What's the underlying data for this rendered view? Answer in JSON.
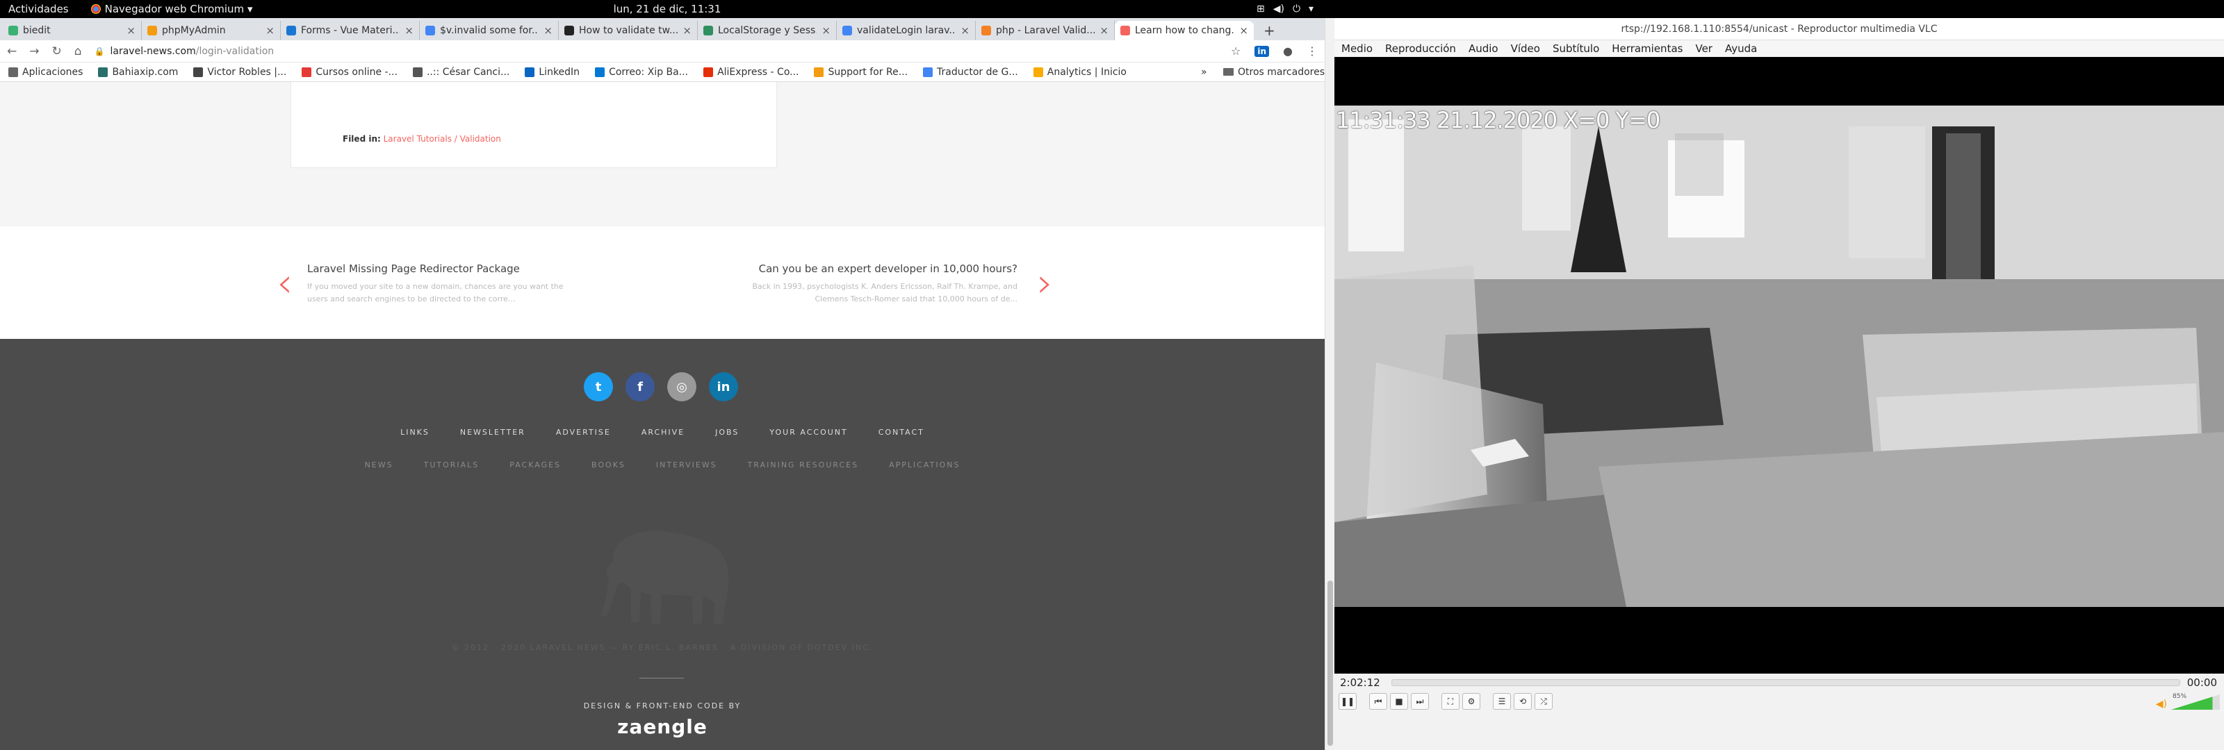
{
  "topbar": {
    "activities": "Actividades",
    "app_name": "Navegador web Chromium ▾",
    "clock": "lun, 21 de dic, 11:31"
  },
  "tabs": [
    {
      "title": "biedit",
      "color": "#3bb273"
    },
    {
      "title": "phpMyAdmin",
      "color": "#f39c12"
    },
    {
      "title": "Forms - Vue Materi...",
      "color": "#1976d2"
    },
    {
      "title": "$v.invalid some for...",
      "color": "#4285f4"
    },
    {
      "title": "How to validate tw...",
      "color": "#222"
    },
    {
      "title": "LocalStorage y Sess...",
      "color": "#2f8f5f"
    },
    {
      "title": "validateLogin larav...",
      "color": "#4285f4"
    },
    {
      "title": "php - Laravel Valid...",
      "color": "#f48024"
    },
    {
      "title": "Learn how to chang...",
      "color": "#f4645f"
    }
  ],
  "address": {
    "host": "laravel-news.com",
    "path": "/login-validation"
  },
  "bookmarks": [
    {
      "label": "Aplicaciones",
      "color": "#666"
    },
    {
      "label": "Bahiaxip.com",
      "color": "#2a6f6a"
    },
    {
      "label": "Victor Robles |...",
      "color": "#444"
    },
    {
      "label": "Cursos online -...",
      "color": "#e53935"
    },
    {
      "label": "..:: César Canci...",
      "color": "#555"
    },
    {
      "label": "LinkedIn",
      "color": "#0a66c2"
    },
    {
      "label": "Correo: Xip Ba...",
      "color": "#0078d4"
    },
    {
      "label": "AliExpress - Co...",
      "color": "#e62e04"
    },
    {
      "label": "Support for Re...",
      "color": "#f39c12"
    },
    {
      "label": "Traductor de G...",
      "color": "#4285f4"
    },
    {
      "label": "Analytics | Inicio",
      "color": "#f9ab00"
    }
  ],
  "bookmarks_more": "»",
  "bookmarks_other": "Otros marcadores",
  "article": {
    "filed_label": "Filed in:",
    "filed_links": "Laravel Tutorials / Validation"
  },
  "prev_post": {
    "title": "Laravel Missing Page Redirector Package",
    "desc1": "If you moved your site to a new domain, chances are you want the",
    "desc2": "users and search engines to be directed to the corre..."
  },
  "next_post": {
    "title": "Can you be an expert developer in 10,000 hours?",
    "desc1": "Back in 1993, psychologists K. Anders Ericsson, Ralf Th. Krampe, and",
    "desc2": "Clemens Tesch-Romer said that 10,000 hours of de..."
  },
  "social": [
    {
      "label": "t",
      "color": "#1da1f2"
    },
    {
      "label": "f",
      "color": "#3b5998"
    },
    {
      "label": "◎",
      "color": "#9a9a9a"
    },
    {
      "label": "in",
      "color": "#0e76a8"
    }
  ],
  "footer_links": [
    "LINKS",
    "NEWSLETTER",
    "ADVERTISE",
    "ARCHIVE",
    "JOBS",
    "YOUR ACCOUNT",
    "CONTACT"
  ],
  "footer_sub": [
    "NEWS",
    "TUTORIALS",
    "PACKAGES",
    "BOOKS",
    "INTERVIEWS",
    "TRAINING RESOURCES",
    "APPLICATIONS"
  ],
  "copyright": "© 2012 - 2020 LARAVEL NEWS — BY ERIC L. BARNES - A DIVISION OF DOTDEV INC.",
  "design_credit": "DESIGN & FRONT-END CODE BY",
  "design_brand": "zaengle",
  "vlc": {
    "title": "rtsp://192.168.1.110:8554/unicast - Reproductor multimedia VLC",
    "menu": [
      "Medio",
      "Reproducción",
      "Audio",
      "Vídeo",
      "Subtítulo",
      "Herramientas",
      "Ver",
      "Ayuda"
    ],
    "osd": "11:31:33 21.12.2020 X=0 Y=0",
    "elapsed": "2:02:12",
    "remaining": "00:00",
    "volume": "85%",
    "volume_level": 0.85
  }
}
